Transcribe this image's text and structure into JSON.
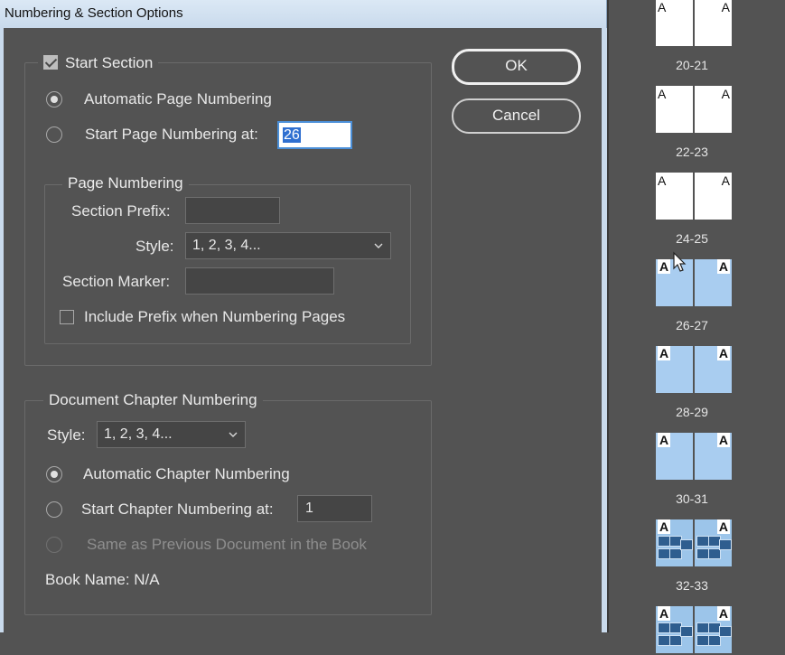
{
  "window": {
    "title": "Numbering & Section Options"
  },
  "section": {
    "start_section_label": "Start Section",
    "start_section_checked": true,
    "auto_page_numbering_label": "Automatic Page Numbering",
    "auto_page_numbering_selected": true,
    "start_page_numbering_label": "Start Page Numbering at:",
    "start_page_value": "26"
  },
  "page_numbering": {
    "legend": "Page Numbering",
    "section_prefix_label": "Section Prefix:",
    "section_prefix_value": "",
    "style_label": "Style:",
    "style_value": "1, 2, 3, 4...",
    "section_marker_label": "Section Marker:",
    "section_marker_value": "",
    "include_prefix_label": "Include Prefix when Numbering Pages",
    "include_prefix_checked": false
  },
  "chapter": {
    "legend": "Document Chapter Numbering",
    "style_label": "Style:",
    "style_value": "1, 2, 3, 4...",
    "auto_chapter_label": "Automatic Chapter Numbering",
    "auto_chapter_selected": true,
    "start_chapter_label": "Start Chapter Numbering at:",
    "start_chapter_value": "1",
    "same_as_previous_label": "Same as Previous Document in the Book",
    "book_name_label": "Book Name: N/A"
  },
  "buttons": {
    "ok": "OK",
    "cancel": "Cancel"
  },
  "pages_panel": {
    "master_letter": "A",
    "spreads": [
      {
        "label": "20-21",
        "style": "plain"
      },
      {
        "label": "22-23",
        "style": "plain"
      },
      {
        "label": "24-25",
        "style": "plain"
      },
      {
        "label": "26-27",
        "style": "blue"
      },
      {
        "label": "28-29",
        "style": "blue"
      },
      {
        "label": "30-31",
        "style": "blue"
      },
      {
        "label": "32-33",
        "style": "photo"
      },
      {
        "label": "",
        "style": "photo"
      }
    ]
  },
  "colors": {
    "dialog_bg": "#535353",
    "title_bar": "#dbe8f5",
    "selection_highlight": "#2f6fd0",
    "focus_border": "#4b8fd8",
    "section_page_blue": "#a9cdf0"
  }
}
